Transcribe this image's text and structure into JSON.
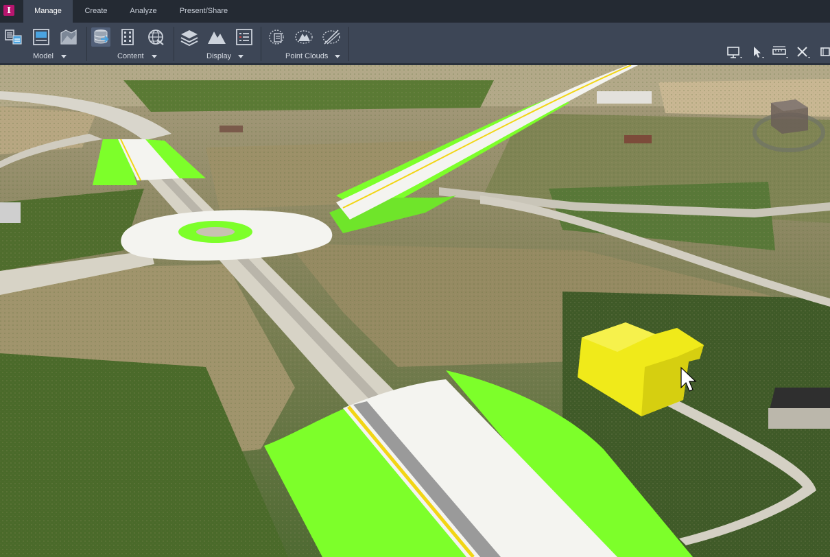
{
  "app": {
    "logo_letter": "I",
    "logo_color": "#b8166f"
  },
  "tabs": [
    {
      "label": "Manage",
      "active": true
    },
    {
      "label": "Create",
      "active": false
    },
    {
      "label": "Analyze",
      "active": false
    },
    {
      "label": "Present/Share",
      "active": false
    }
  ],
  "ribbon": {
    "groups": [
      {
        "label": "Model",
        "buttons": [
          "model-explorer-icon",
          "layout-icon",
          "terrain-map-icon"
        ]
      },
      {
        "label": "Content",
        "buttons": [
          "data-sources-icon",
          "building-grid-icon",
          "globe-network-icon"
        ]
      },
      {
        "label": "Display",
        "buttons": [
          "layers-icon",
          "terrain-peaks-icon",
          "list-icon"
        ]
      },
      {
        "label": "Point Clouds",
        "buttons": [
          "point-cloud-icon",
          "point-cloud-terrain-icon",
          "point-cloud-slice-icon"
        ]
      }
    ],
    "right_tools": [
      "presentation-screen-icon",
      "select-arrow-icon",
      "measure-ruler-icon",
      "close-x-icon",
      "window-icon"
    ]
  },
  "scene": {
    "description_colors": {
      "proposed_road": "#ffffff",
      "slope_grading": "#7dff2a",
      "building": "#f0ea1a",
      "centerline": "#f2d514"
    },
    "selected_object": "building-model"
  }
}
